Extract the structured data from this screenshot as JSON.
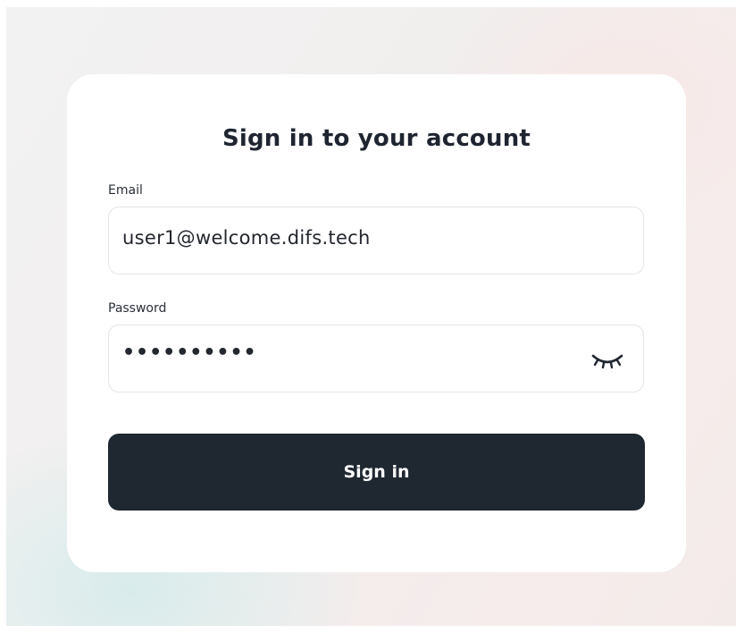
{
  "form": {
    "title": "Sign in to your account",
    "email_label": "Email",
    "email_value": "user1@welcome.difs.tech",
    "password_label": "Password",
    "password_value": "••••••••••",
    "password_toggle_icon": "eye-closed-icon",
    "submit_label": "Sign in"
  },
  "colors": {
    "button_bg": "#1f2730",
    "button_text": "#ffffff",
    "title_text": "#1f2530",
    "card_bg": "#ffffff",
    "field_border": "#e3e5e8"
  }
}
